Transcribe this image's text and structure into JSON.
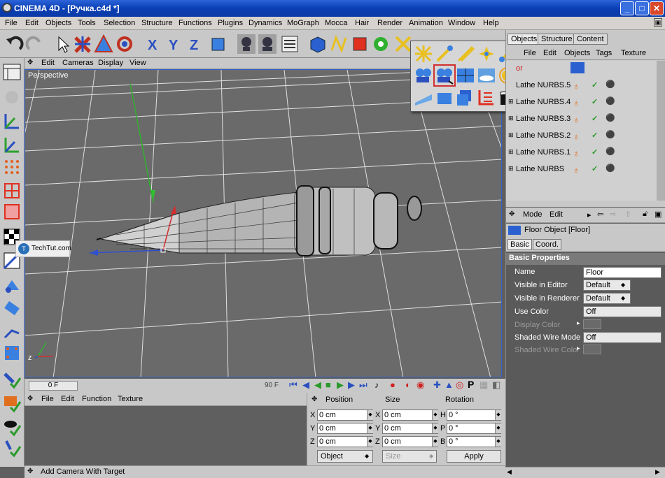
{
  "window": {
    "title": "CINEMA 4D - [Ручка.c4d *]",
    "min_label": "_",
    "max_label": "□",
    "close_label": "✕"
  },
  "menu": [
    "File",
    "Edit",
    "Objects",
    "Tools",
    "Selection",
    "Structure",
    "Functions",
    "Plugins",
    "Dynamics",
    "MoGraph",
    "Mocca",
    "Hair",
    "Render",
    "Animation",
    "Window",
    "Help"
  ],
  "viewport": {
    "menu": [
      "Edit",
      "Cameras",
      "Display",
      "View"
    ],
    "label": "Perspective",
    "axis_z": "z"
  },
  "watermark": {
    "text": "TechTut.com"
  },
  "timeline": {
    "current_frame": "0 F",
    "end_frame": "90 F"
  },
  "materials": {
    "menu": [
      "File",
      "Edit",
      "Function",
      "Texture"
    ]
  },
  "coords": {
    "headers": [
      "Position",
      "Size",
      "Rotation"
    ],
    "rows": [
      {
        "pos_axis": "X",
        "pos": "0 cm",
        "size_axis": "X",
        "size": "0 cm",
        "rot_axis": "H",
        "rot": "0 °"
      },
      {
        "pos_axis": "Y",
        "pos": "0 cm",
        "size_axis": "Y",
        "size": "0 cm",
        "rot_axis": "P",
        "rot": "0 °"
      },
      {
        "pos_axis": "Z",
        "pos": "0 cm",
        "size_axis": "Z",
        "size": "0 cm",
        "rot_axis": "B",
        "rot": "0 °"
      }
    ],
    "mode": "Object",
    "size_mode": "Size",
    "apply": "Apply"
  },
  "status": {
    "text": "Add Camera With Target"
  },
  "objects_panel": {
    "tabs": [
      "Objects",
      "Structure",
      "Content"
    ],
    "menu": [
      "File",
      "Edit",
      "Objects",
      "Tags",
      "Texture"
    ],
    "first_row_partial": "or",
    "items": [
      "Lathe NURBS.5",
      "Lathe NURBS.4",
      "Lathe NURBS.3",
      "Lathe NURBS.2",
      "Lathe NURBS.1",
      "Lathe NURBS"
    ]
  },
  "attributes": {
    "menu": [
      "Mode",
      "Edit"
    ],
    "object_title": "Floor Object [Floor]",
    "tabs": [
      "Basic",
      "Coord."
    ],
    "section": "Basic Properties",
    "fields": [
      {
        "label": "Name",
        "value": "Floor"
      },
      {
        "label": "Visible in Editor",
        "value": "Default"
      },
      {
        "label": "Visible in Renderer",
        "value": "Default"
      },
      {
        "label": "Use Color",
        "value": "Off"
      },
      {
        "label": "Display Color",
        "value": ""
      },
      {
        "label": "Shaded Wire Mode",
        "value": "Off"
      },
      {
        "label": "Shaded Wire Color",
        "value": ""
      }
    ]
  },
  "colors": {
    "accent": "#0a3fb4",
    "viewport_bg": "#6a6a6a",
    "check": "#2a9a2a"
  }
}
